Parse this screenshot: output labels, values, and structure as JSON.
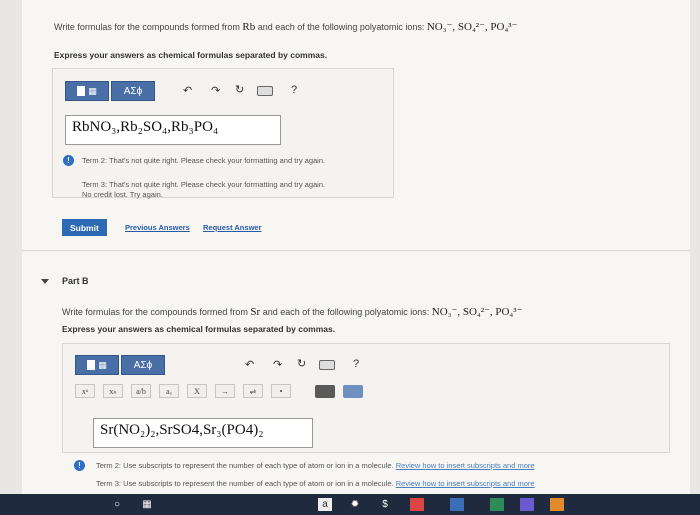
{
  "partA": {
    "question_prefix": "Write formulas for the compounds formed from ",
    "element": "Rb",
    "question_middle": " and each of the following polyatomic ions: ",
    "ions": "NO₃⁻, SO₄²⁻, PO₄³⁻",
    "instruction": "Express your answers as chemical formulas separated by commas.",
    "greek_label": "AΣϕ",
    "help_label": "?",
    "answer": "RbNO₃,Rb₂SO₄,Rb₃PO₄",
    "feedback": [
      {
        "text": "Term 2: That's not quite right. Please check your formatting and try again."
      },
      {
        "text": "Term 3: That's not quite right. Please check your formatting and try again."
      }
    ],
    "no_credit": "No credit lost. Try again.",
    "submit_label": "Submit",
    "previous_answers_label": "Previous Answers",
    "request_answer_label": "Request Answer"
  },
  "partB": {
    "title": "Part B",
    "question_prefix": "Write formulas for the compounds formed from ",
    "element": "Sr",
    "question_middle": " and each of the following polyatomic ions: ",
    "ions": "NO₃⁻, SO₄²⁻, PO₄³⁻",
    "instruction": "Express your answers as chemical formulas separated by commas.",
    "greek_label": "AΣϕ",
    "help_label": "?",
    "symbols": [
      "xᵃ",
      "xₕ",
      "a/b",
      "aₓ",
      "X",
      "→",
      "⇌",
      "•"
    ],
    "answer": "Sr(NO₂)₂,SrSO4,Sr₃(PO4)₂",
    "feedback": [
      {
        "text": "Term 2: Use subscripts to represent the number of each type of atom or ion in a molecule.",
        "link": "Review how to insert subscripts and more"
      },
      {
        "text": "Term 3: Use subscripts to represent the number of each type of atom or ion in a molecule.",
        "link": "Review how to insert subscripts and more"
      }
    ]
  },
  "colors": {
    "accent": "#4a6fa6",
    "submit": "#2e69b3",
    "info": "#2e6fc3"
  }
}
